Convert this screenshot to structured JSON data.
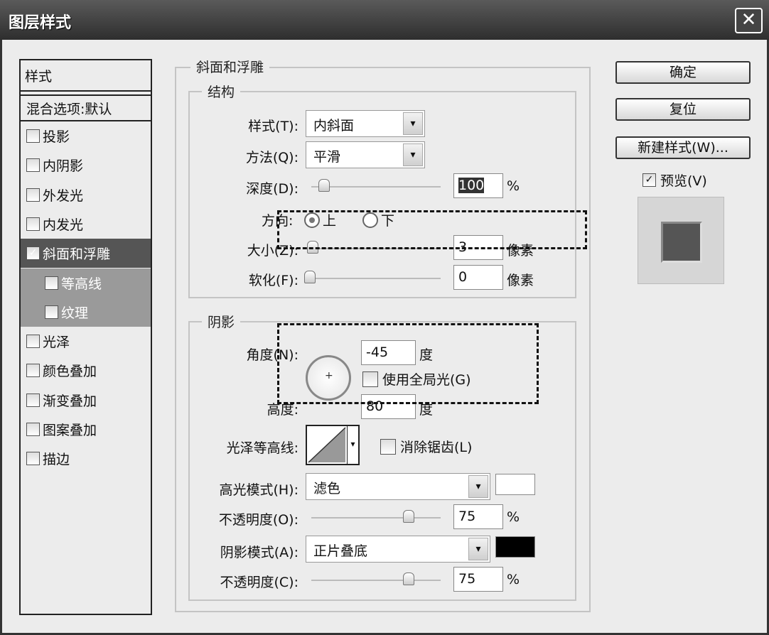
{
  "window": {
    "title": "图层样式",
    "close": "✕"
  },
  "styles_list": {
    "header": "样式",
    "blend_options": "混合选项:默认",
    "items": [
      {
        "label": "投影",
        "checked": false
      },
      {
        "label": "内阴影",
        "checked": false
      },
      {
        "label": "外发光",
        "checked": false
      },
      {
        "label": "内发光",
        "checked": false
      },
      {
        "label": "斜面和浮雕",
        "checked": true
      },
      {
        "label": "等高线",
        "checked": false
      },
      {
        "label": "纹理",
        "checked": false
      },
      {
        "label": "光泽",
        "checked": false
      },
      {
        "label": "颜色叠加",
        "checked": false
      },
      {
        "label": "渐变叠加",
        "checked": false
      },
      {
        "label": "图案叠加",
        "checked": false
      },
      {
        "label": "描边",
        "checked": false
      }
    ]
  },
  "bevel": {
    "title": "斜面和浮雕",
    "structure": {
      "title": "结构",
      "style_label": "样式(T):",
      "style_value": "内斜面",
      "technique_label": "方法(Q):",
      "technique_value": "平滑",
      "depth_label": "深度(D):",
      "depth_value": "100",
      "depth_unit": "%",
      "depth_slider": 0.1,
      "direction_label": "方向:",
      "dir_up": "上",
      "dir_down": "下",
      "direction_selected": "上",
      "size_label": "大小(Z):",
      "size_value": "3",
      "size_unit": "像素",
      "soften_label": "软化(F):",
      "soften_value": "0",
      "soften_unit": "像素"
    },
    "shading": {
      "title": "阴影",
      "angle_label": "角度(N):",
      "angle_value": "-45",
      "angle_unit": "度",
      "global_light_label": "使用全局光(G)",
      "global_light": false,
      "altitude_label": "高度:",
      "altitude_value": "80",
      "altitude_unit": "度",
      "gloss_label": "光泽等高线:",
      "anti_alias_label": "消除锯齿(L)",
      "anti_alias": false,
      "highlight_mode_label": "高光模式(H):",
      "highlight_mode": "滤色",
      "highlight_color": "#ffffff",
      "highlight_opacity_label": "不透明度(O):",
      "highlight_opacity": "75",
      "pct": "%",
      "shadow_mode_label": "阴影模式(A):",
      "shadow_mode": "正片叠底",
      "shadow_color": "#000000",
      "shadow_opacity_label": "不透明度(C):",
      "shadow_opacity": "75"
    }
  },
  "buttons": {
    "ok": "确定",
    "reset": "复位",
    "new_style": "新建样式(W)...",
    "preview_label": "预览(V)",
    "preview_checked": true
  },
  "dropdown_glyph": "▾",
  "check_glyph": "✓"
}
